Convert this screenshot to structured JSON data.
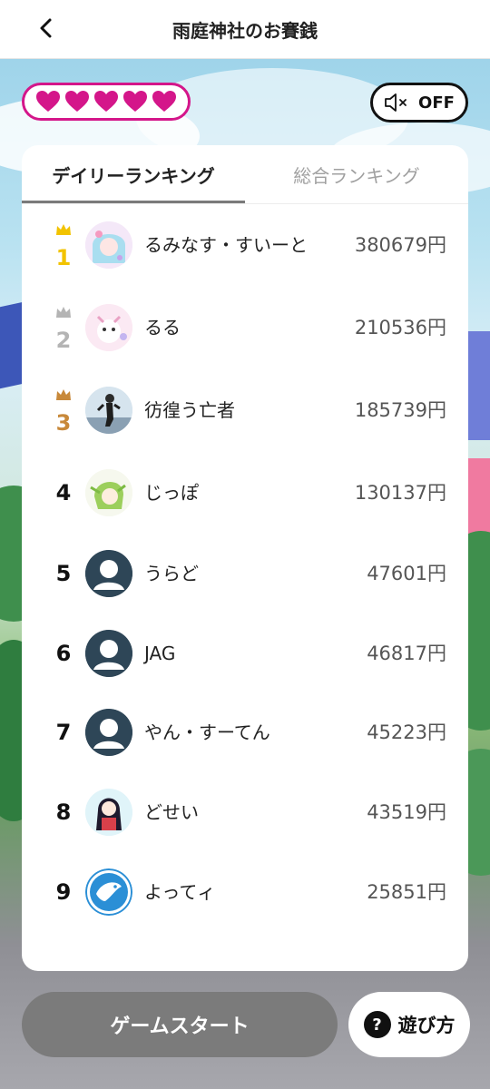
{
  "header": {
    "title": "雨庭神社のお賽銭",
    "back_icon": "chevron-left-icon"
  },
  "lives": {
    "count": 5,
    "color": "#d4168a"
  },
  "sound": {
    "label": "OFF",
    "icon": "speaker-muted-icon"
  },
  "tabs": [
    {
      "label": "デイリーランキング",
      "active": true
    },
    {
      "label": "総合ランキング",
      "active": false
    }
  ],
  "ranking": [
    {
      "rank": "1",
      "name": "るみなす・すいーと",
      "amount": "380679円",
      "crown": "gold"
    },
    {
      "rank": "2",
      "name": "るる",
      "amount": "210536円",
      "crown": "silver"
    },
    {
      "rank": "3",
      "name": "彷徨う亡者",
      "amount": "185739円",
      "crown": "bronze"
    },
    {
      "rank": "4",
      "name": "じっぽ",
      "amount": "130137円",
      "crown": ""
    },
    {
      "rank": "5",
      "name": "うらど",
      "amount": "47601円",
      "crown": ""
    },
    {
      "rank": "6",
      "name": "JAG",
      "amount": "46817円",
      "crown": ""
    },
    {
      "rank": "7",
      "name": "やん・すーてん",
      "amount": "45223円",
      "crown": ""
    },
    {
      "rank": "8",
      "name": "どせい",
      "amount": "43519円",
      "crown": ""
    },
    {
      "rank": "9",
      "name": "よってィ",
      "amount": "25851円",
      "crown": ""
    }
  ],
  "buttons": {
    "start_label": "ゲームスタート",
    "howto_label": "遊び方"
  },
  "colors": {
    "gold": "#f2c300",
    "silver": "#b4b4b4",
    "bronze": "#c8893a"
  }
}
